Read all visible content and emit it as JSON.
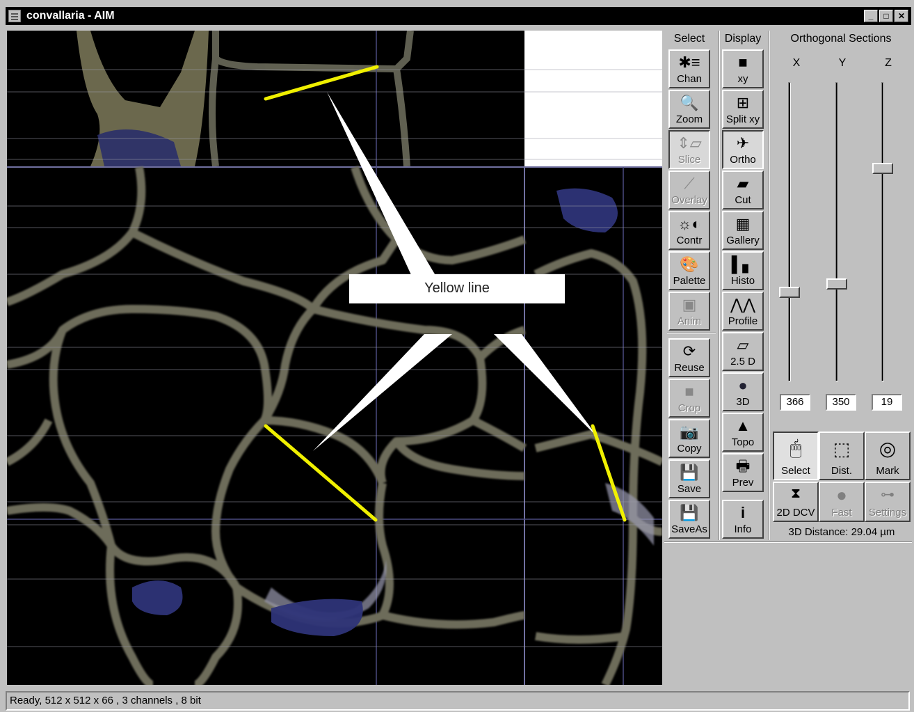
{
  "window": {
    "title": "convallaria - AIM"
  },
  "columns": {
    "select": "Select",
    "display": "Display",
    "ortho": "Orthogonal Sections"
  },
  "select_tools": [
    {
      "label": "Chan",
      "enabled": true
    },
    {
      "label": "Zoom",
      "enabled": true
    },
    {
      "label": "Slice",
      "enabled": false
    },
    {
      "label": "Overlay",
      "enabled": false
    },
    {
      "label": "Contr",
      "enabled": true
    },
    {
      "label": "Palette",
      "enabled": true
    },
    {
      "label": "Anim",
      "enabled": false
    },
    {
      "label": "Reuse",
      "enabled": true
    },
    {
      "label": "Crop",
      "enabled": false
    },
    {
      "label": "Copy",
      "enabled": true
    },
    {
      "label": "Save",
      "enabled": true
    },
    {
      "label": "SaveAs",
      "enabled": true
    }
  ],
  "display_tools": [
    {
      "label": "xy"
    },
    {
      "label": "Split xy"
    },
    {
      "label": "Ortho",
      "active": true
    },
    {
      "label": "Cut"
    },
    {
      "label": "Gallery"
    },
    {
      "label": "Histo"
    },
    {
      "label": "Profile"
    },
    {
      "label": "2.5 D"
    },
    {
      "label": "3D"
    },
    {
      "label": "Topo"
    },
    {
      "label": "Prev"
    },
    {
      "label": "Info"
    }
  ],
  "axes": {
    "x": {
      "label": "X",
      "value": "366"
    },
    "y": {
      "label": "Y",
      "value": "350"
    },
    "z": {
      "label": "Z",
      "value": "19"
    }
  },
  "sliders": {
    "x_level": 0.71,
    "y_level": 0.68,
    "z_level": 0.28
  },
  "measure_buttons": {
    "select": "Select",
    "dist": "Dist.",
    "mark": "Mark",
    "dcv": "2D DCV",
    "fast": "Fast",
    "settings": "Settings"
  },
  "distance_text": "3D Distance: 29.04 µm",
  "annotation": "Yellow line",
  "status": "Ready, 512 x 512 x 66 , 3 channels , 8 bit"
}
